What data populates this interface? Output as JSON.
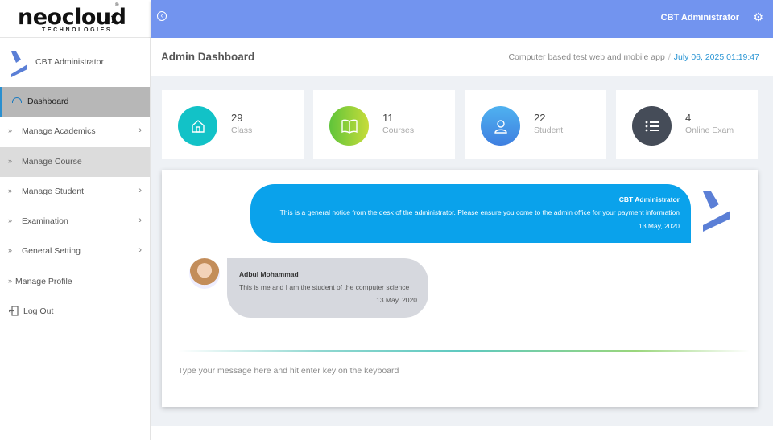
{
  "brand": {
    "name": "neocloud",
    "arrow": "›",
    "tagline": "TECHNOLOGIES",
    "reg": "®"
  },
  "topbar": {
    "back_icon": "arrow-left-circle-icon",
    "user": "CBT Administrator",
    "settings_icon": "gear-icon"
  },
  "sidebar": {
    "profile_name": "CBT Administrator",
    "items": [
      {
        "label": "Dashboard",
        "icon": "dashboard-icon",
        "active": true
      },
      {
        "label": "Manage Academics",
        "has_submenu": true
      },
      {
        "label": "Manage Course",
        "highlighted": true
      },
      {
        "label": "Manage Student",
        "has_submenu": true
      },
      {
        "label": "Examination",
        "has_submenu": true
      },
      {
        "label": "General Setting",
        "has_submenu": true
      },
      {
        "label": "Manage Profile"
      },
      {
        "label": "Log Out",
        "icon": "logout-icon"
      }
    ]
  },
  "header": {
    "title": "Admin Dashboard",
    "subtitle": "Computer based test web and mobile app",
    "separator": "/",
    "datetime": "July 06, 2025 01:19:47"
  },
  "stats": [
    {
      "value": "29",
      "label": "Class",
      "icon": "home-icon",
      "color": "#12c2c7"
    },
    {
      "value": "11",
      "label": "Courses",
      "icon": "book-icon",
      "color": "#8ccf3a"
    },
    {
      "value": "22",
      "label": "Student",
      "icon": "user-icon",
      "color": "#3f8fe6"
    },
    {
      "value": "4",
      "label": "Online Exam",
      "icon": "list-icon",
      "color": "#454c58"
    }
  ],
  "chat": {
    "messages": [
      {
        "author": "CBT Administrator",
        "text": "This is a general notice from the desk of the administrator. Please ensure you come to the admin office for your payment information",
        "date": "13 May, 2020"
      },
      {
        "author": "Adbul Mohammad",
        "text": "This is me and I am the student of the computer science",
        "date": "13 May, 2020"
      }
    ],
    "input_placeholder": "Type your message here and hit enter key on the keyboard"
  }
}
